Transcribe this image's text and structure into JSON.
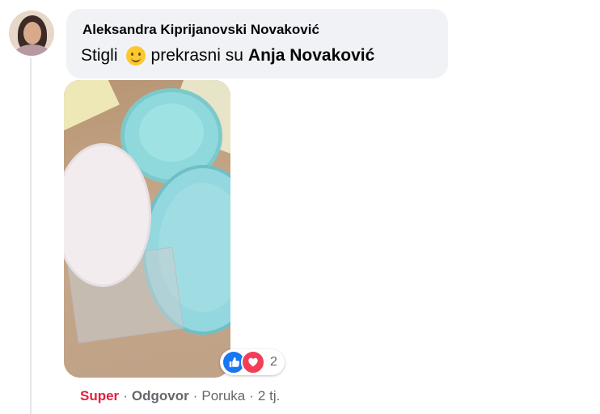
{
  "comment": {
    "author": "Aleksandra Kiprijanovski Novaković",
    "text_before": "Stigli",
    "emoji": "slightly-smiling-face",
    "text_after": "prekrasni su",
    "tagged_user": "Anja Novaković"
  },
  "reactions": {
    "icons": [
      "like-icon",
      "love-icon"
    ],
    "count": "2"
  },
  "actions": {
    "super": "Super",
    "reply": "Odgovor",
    "message": "Poruka",
    "time": "2 tj.",
    "separator": "·"
  },
  "colors": {
    "bubble": "#f0f2f5",
    "super": "#e41e3f",
    "like": "#1877f2",
    "love": "#f33e58"
  }
}
